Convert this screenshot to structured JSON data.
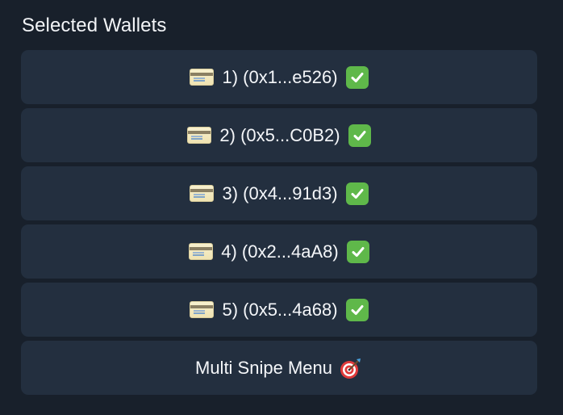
{
  "header": {
    "title": "Selected Wallets"
  },
  "wallets": [
    {
      "label": "1) (0x1...e526)"
    },
    {
      "label": "2) (0x5...C0B2)"
    },
    {
      "label": "3) (0x4...91d3)"
    },
    {
      "label": "4) (0x2...4aA8)"
    },
    {
      "label": "5) (0x5...4a68)"
    }
  ],
  "menu_button": {
    "label": "Multi Snipe Menu"
  },
  "icons": {
    "wallet_icon": "credit-card-icon",
    "selected_icon": "check-mark-button-icon",
    "menu_icon": "direct-hit-dart-icon"
  },
  "colors": {
    "background": "#18202b",
    "button": "#232f3f",
    "text": "#f4f6f9",
    "check": "#5fb84a"
  }
}
